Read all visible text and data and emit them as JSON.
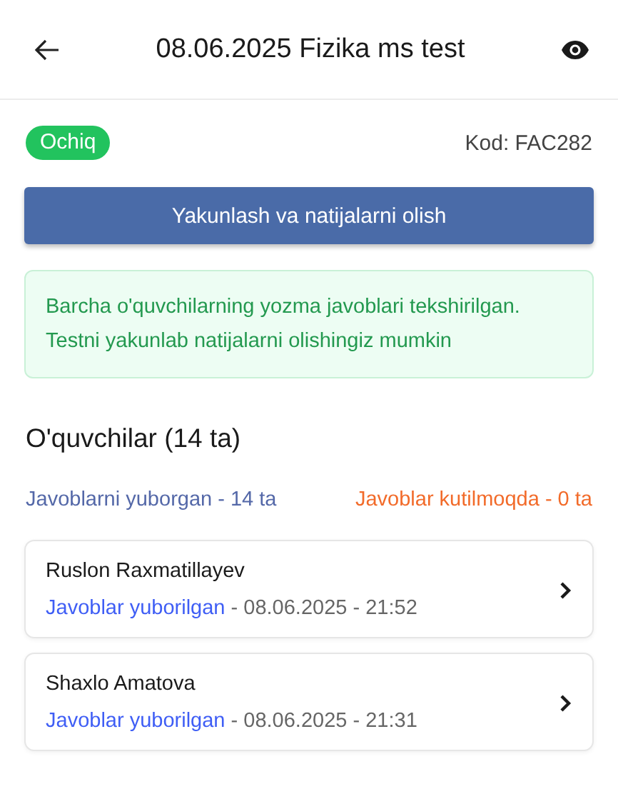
{
  "header": {
    "title": "08.06.2025 Fizika ms test"
  },
  "status": {
    "label": "Ochiq",
    "code": "Kod: FAC282"
  },
  "finish_button": {
    "label": "Yakunlash va natijalarni olish"
  },
  "alert": {
    "kind": "success",
    "text": "Barcha o'quvchilarning yozma javoblari tekshirilgan. Testni yakunlab natijalarni olishingiz mumkin"
  },
  "students_heading": "O'quvchilar (14 ta)",
  "counts": [
    {
      "kind": "submitted",
      "text": "Javoblarni yuborgan - 14 ta"
    },
    {
      "kind": "waiting",
      "text": "Javoblar kutilmoqda - 0 ta"
    }
  ],
  "students": [
    {
      "name": "Ruslon Raxmatillayev",
      "kind": "submitted",
      "status": "Javoblar yuborilgan",
      "time": "- 08.06.2025 - 21:52"
    },
    {
      "name": "Shaxlo Amatova",
      "kind": "submitted",
      "status": "Javoblar yuborilgan",
      "time": "- 08.06.2025 - 21:31"
    }
  ]
}
